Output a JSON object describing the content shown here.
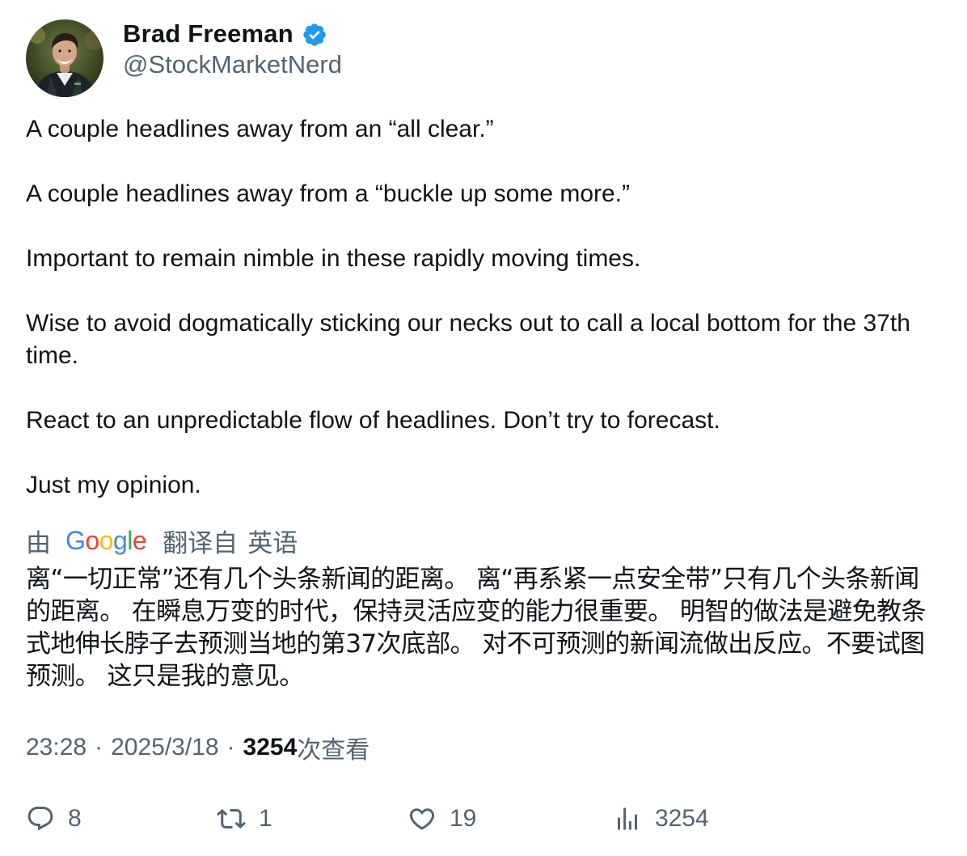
{
  "author": {
    "display_name": "Brad Freeman",
    "handle": "@StockMarketNerd",
    "verified": true,
    "verified_color": "#1D9BF0",
    "avatar": "profile-photo"
  },
  "tweet": {
    "paragraphs": [
      "A couple headlines away from an “all clear.”",
      "A couple headlines away from a “buckle up some more.”",
      "Important to remain nimble in these rapidly moving times.",
      "Wise to avoid dogmatically sticking our necks out to call a local bottom for the 37th time.",
      "React to an unpredictable flow of headlines. Don’t try to forecast.",
      "Just my opinion."
    ]
  },
  "translation": {
    "by_label": "由",
    "provider": "Google",
    "translated_from_label": "翻译自",
    "source_language": "英语",
    "text": "离“一切正常”还有几个头条新闻的距离。 离“再系紧一点安全带”只有几个头条新闻的距离。 在瞬息万变的时代，保持灵活应变的能力很重要。 明智的做法是避免教条式地伸长脖子去预测当地的第37次底部。 对不可预测的新闻流做出反应。不要试图预测。 这只是我的意见。"
  },
  "meta": {
    "time": "23:28",
    "separator": "·",
    "date": "2025/3/18",
    "views_count": "3254",
    "views_label": "次查看"
  },
  "actions": {
    "replies": "8",
    "retweets": "1",
    "likes": "19",
    "views": "3254"
  },
  "colors": {
    "text_primary": "#0f1419",
    "text_secondary": "#536471",
    "accent": "#1D9BF0"
  }
}
